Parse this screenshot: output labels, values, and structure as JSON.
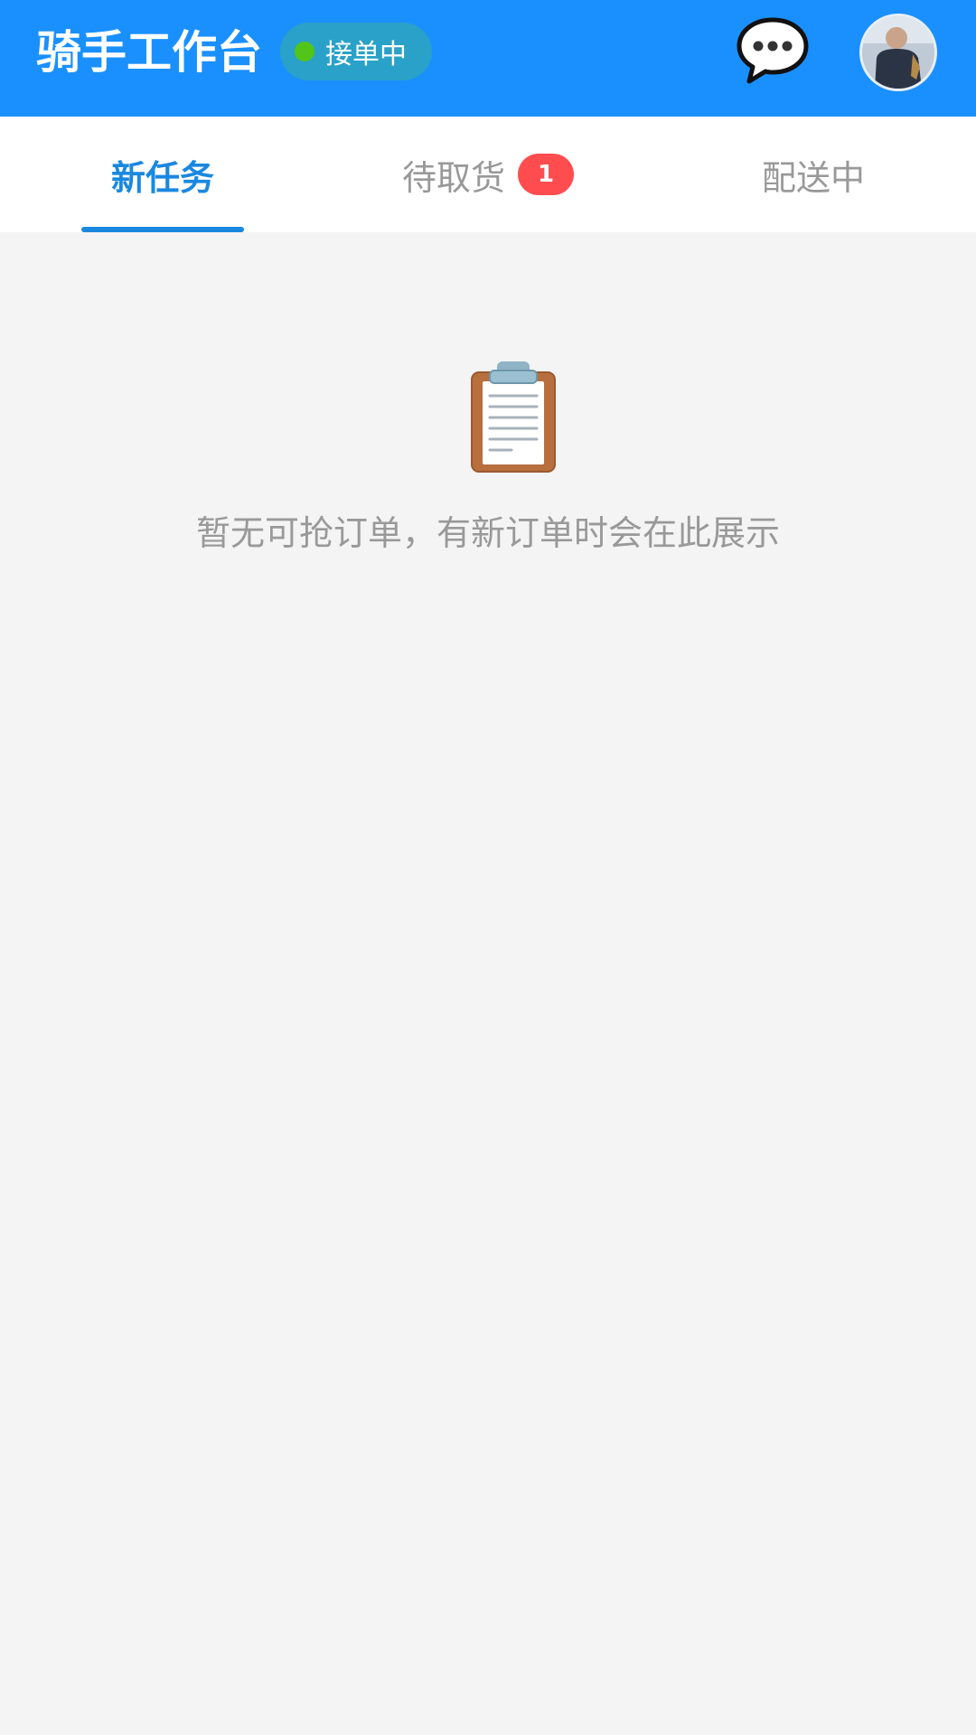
{
  "header": {
    "title": "骑手工作台",
    "status": {
      "label": "接单中",
      "dot_color": "#52c41a"
    },
    "message_icon": "chat-bubble-icon",
    "avatar": "user-avatar"
  },
  "tabs": [
    {
      "label": "新任务",
      "active": true
    },
    {
      "label": "待取货",
      "badge": "1"
    },
    {
      "label": "配送中"
    }
  ],
  "empty_state": {
    "icon": "clipboard-icon",
    "message": "暂无可抢订单，有新订单时会在此展示"
  },
  "colors": {
    "header_bg": "#1a90ff",
    "accent": "#1a88e0",
    "badge": "#ff4d4f",
    "page_bg": "#f4f4f4"
  }
}
